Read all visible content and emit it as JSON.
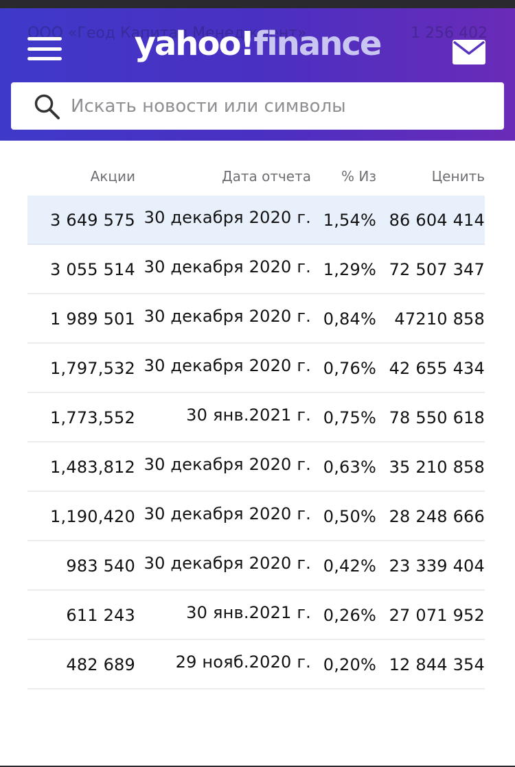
{
  "header": {
    "ghost_left": "ООО «Геод Капитал Менеджмент»",
    "ghost_right": "1 256 402",
    "logo_main": "yahoo!",
    "logo_sub": "finance",
    "icons": {
      "menu": "hamburger-menu-icon",
      "mail": "mail-icon",
      "search": "search-icon"
    },
    "colors": {
      "gradient_start": "#3f39c9",
      "gradient_end": "#6a2bb8"
    }
  },
  "search": {
    "placeholder": "Искать новости или символы",
    "value": ""
  },
  "table": {
    "headers": {
      "shares": "Акции",
      "date": "Дата отчета",
      "pct": "% Из",
      "value": "Ценить"
    },
    "rows": [
      {
        "shares": "3 649 575",
        "date": "30 декабря 2020 г.",
        "pct": "1,54%",
        "value": "86 604 414"
      },
      {
        "shares": "3 055 514",
        "date": "30 декабря 2020 г.",
        "pct": "1,29%",
        "value": "72 507 347"
      },
      {
        "shares": "1 989 501",
        "date": "30 декабря 2020 г.",
        "pct": "0,84%",
        "value": "47210 858"
      },
      {
        "shares": "1,797,532",
        "date": "30 декабря 2020 г.",
        "pct": "0,76%",
        "value": "42 655 434"
      },
      {
        "shares": "1,773,552",
        "date": "30 янв.2021 г.",
        "pct": "0,75%",
        "value": "78 550 618"
      },
      {
        "shares": "1,483,812",
        "date": "30 декабря 2020 г.",
        "pct": "0,63%",
        "value": "35 210 858"
      },
      {
        "shares": "1,190,420",
        "date": "30 декабря 2020 г.",
        "pct": "0,50%",
        "value": "28 248 666"
      },
      {
        "shares": "983 540",
        "date": "30 декабря 2020 г.",
        "pct": "0,42%",
        "value": "23 339 404"
      },
      {
        "shares": "611 243",
        "date": "30 янв.2021 г.",
        "pct": "0,26%",
        "value": "27 071 952"
      },
      {
        "shares": "482 689",
        "date": "29 нояб.2020 г.",
        "pct": "0,20%",
        "value": "12 844 354"
      }
    ],
    "highlight_color": "#e8f0fc"
  }
}
